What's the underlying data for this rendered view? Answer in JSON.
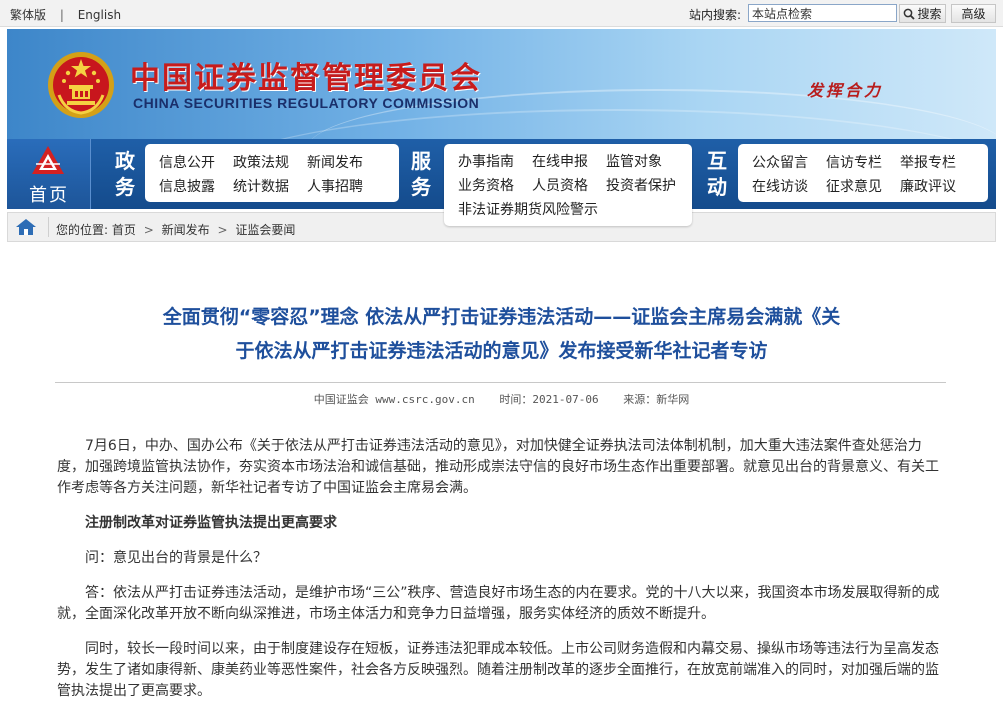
{
  "topbar": {
    "lang_traditional": "繁体版",
    "separator": "|",
    "lang_english": "English",
    "search_label": "站内搜索:",
    "search_placeholder": "本站点检索",
    "search_button": "搜索",
    "advanced_button": "高级"
  },
  "header": {
    "title_cn": "中国证券监督管理委员会",
    "title_en": "CHINA SECURITIES REGULATORY COMMISSION",
    "slogan": "发挥合力"
  },
  "nav": {
    "home_label": "首页",
    "sections": [
      {
        "title": "政务",
        "items": [
          [
            "信息公开",
            "政策法规",
            "新闻发布"
          ],
          [
            "信息披露",
            "统计数据",
            "人事招聘"
          ]
        ]
      },
      {
        "title": "服务",
        "items": [
          [
            "办事指南",
            "在线申报",
            "监管对象"
          ],
          [
            "业务资格",
            "人员资格",
            "投资者保护"
          ],
          [
            "非法证券期货风险警示"
          ]
        ]
      },
      {
        "title": "互动",
        "items": [
          [
            "公众留言",
            "信访专栏",
            "举报专栏"
          ],
          [
            "在线访谈",
            "征求意见",
            "廉政评议"
          ]
        ]
      }
    ]
  },
  "breadcrumb": {
    "prefix": "您的位置:",
    "items": [
      "首页",
      "新闻发布",
      "证监会要闻"
    ],
    "arrow": ">"
  },
  "article": {
    "title_line1": "全面贯彻“零容忍”理念 依法从严打击证券违法活动——证监会主席易会满就《关",
    "title_line2": "于依法从严打击证券违法活动的意见》发布接受新华社记者专访",
    "source": "中国证监会 www.csrc.gov.cn",
    "date": "时间：2021-07-06",
    "origin": "来源：新华网",
    "paragraphs": [
      {
        "type": "text",
        "text": "7月6日，中办、国办公布《关于依法从严打击证券违法活动的意见》，对加快健全证券执法司法体制机制，加大重大违法案件查处惩治力度，加强跨境监管执法协作，夯实资本市场法治和诚信基础，推动形成崇法守信的良好市场生态作出重要部署。就意见出台的背景意义、有关工作考虑等各方关注问题，新华社记者专访了中国证监会主席易会满。"
      },
      {
        "type": "sub",
        "text": "注册制改革对证券监管执法提出更高要求"
      },
      {
        "type": "text",
        "text": "问：意见出台的背景是什么？"
      },
      {
        "type": "text",
        "text": "答：依法从严打击证券违法活动，是维护市场“三公”秩序、营造良好市场生态的内在要求。党的十八大以来，我国资本市场发展取得新的成就，全面深化改革开放不断向纵深推进，市场主体活力和竞争力日益增强，服务实体经济的质效不断提升。"
      },
      {
        "type": "text",
        "text": "同时，较长一段时间以来，由于制度建设存在短板，证券违法犯罪成本较低。上市公司财务造假和内幕交易、操纵市场等违法行为呈高发态势，发生了诸如康得新、康美药业等恶性案件，社会各方反映强烈。随着注册制改革的逐步全面推行，在放宽前端准入的同时，对加强后端的监管执法提出了更高要求。"
      }
    ]
  },
  "colors": {
    "title_red": "#c71c1c",
    "headline_blue": "#1e4f9c",
    "nav_blue": "#1a5aa2"
  }
}
